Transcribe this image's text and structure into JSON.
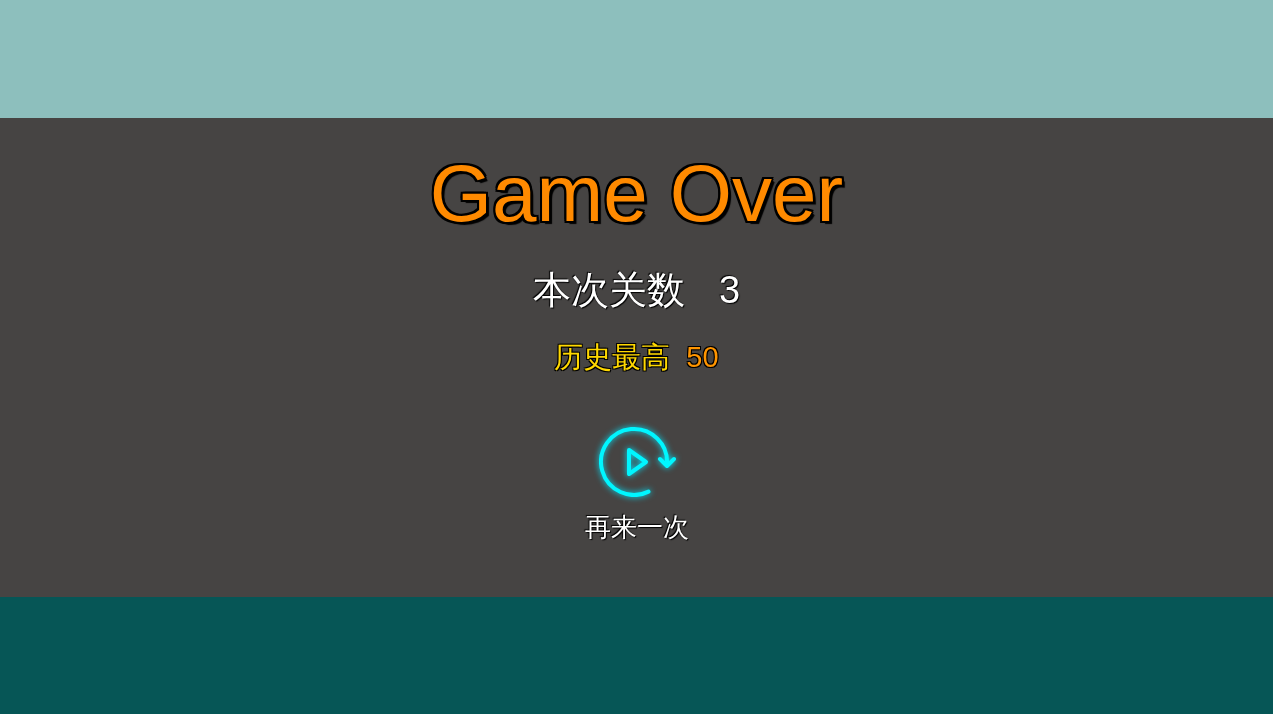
{
  "title": "Game Over",
  "current_level": {
    "label": "本次关数",
    "value": "3"
  },
  "best_record": {
    "label": "历史最高",
    "value": "50"
  },
  "replay_button": {
    "label": "再来一次"
  }
}
